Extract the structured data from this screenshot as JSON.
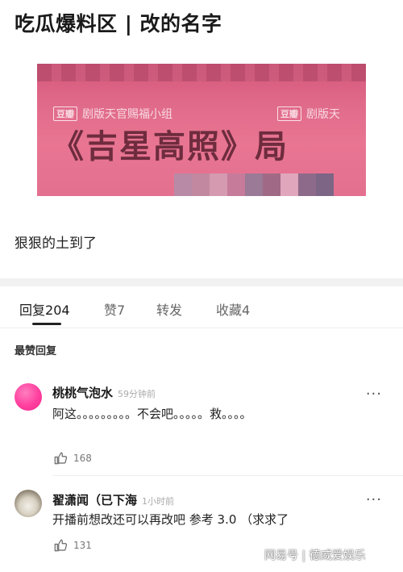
{
  "post": {
    "title": "吃瓜爆料区 | 改的名字",
    "image": {
      "book_title": "《吉星高照》局",
      "watermark_logo": "豆瓣",
      "watermark_text_1": "剧版天官赐福小组",
      "watermark_text_2": "剧版天"
    },
    "body": "狠狠的土到了"
  },
  "tabs": [
    {
      "label": "回复",
      "count": "204",
      "active": true
    },
    {
      "label": "赞",
      "count": "7",
      "active": false
    },
    {
      "label": "转发",
      "count": "",
      "active": false
    },
    {
      "label": "收藏",
      "count": "4",
      "active": false
    }
  ],
  "section_label": "最赞回复",
  "comments": [
    {
      "author": "桃桃气泡水",
      "time": "59分钟前",
      "avatar_icon": "pink-circle-avatar",
      "text": "阿这。。。。。。。。。不会吧。。。。。救。。。。",
      "likes": "168"
    },
    {
      "author": "翟潇闻（已下海",
      "time": "1小时前",
      "avatar_icon": "cat-photo-avatar",
      "text": "开播前想改还可以再改吧 参考 3.0 （求求了",
      "likes": "131"
    }
  ],
  "more_icon": "···",
  "footer_watermark": "网易号 | 德威爱娱乐"
}
